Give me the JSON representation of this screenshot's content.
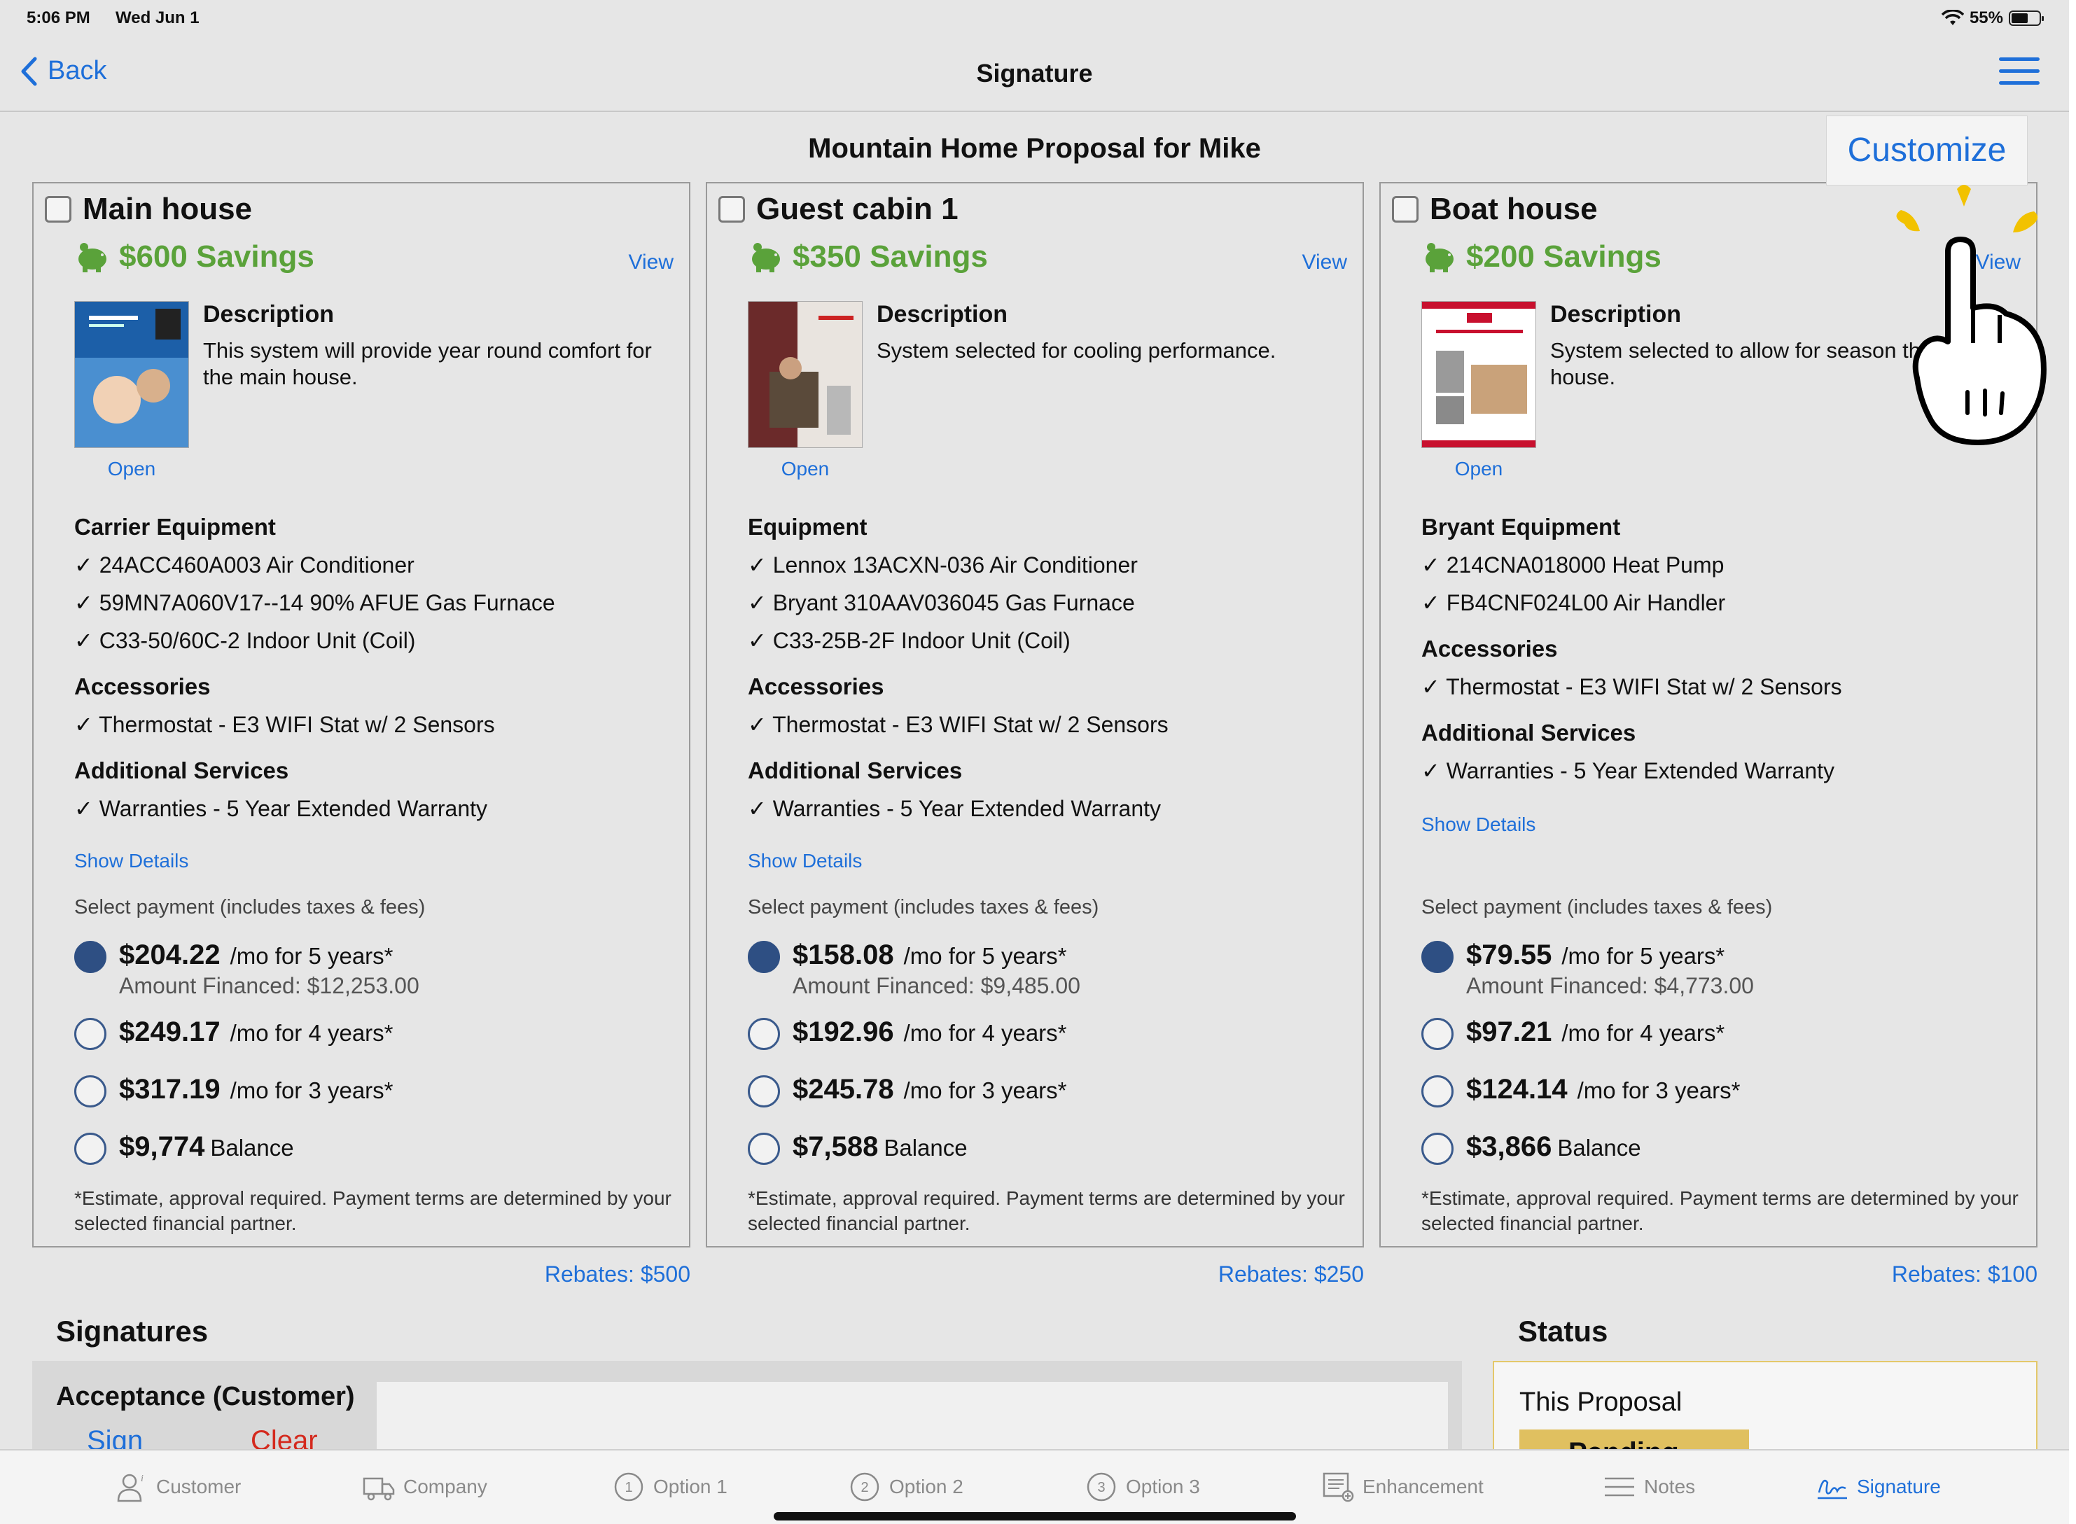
{
  "status_bar": {
    "time": "5:06 PM",
    "date": "Wed Jun 1",
    "battery": "55%"
  },
  "nav": {
    "back_label": "Back",
    "title": "Signature"
  },
  "proposal": {
    "title": "Mountain Home Proposal for Mike",
    "customize_label": "Customize"
  },
  "colors": {
    "accent": "#1e6fd9",
    "savings": "#5aa23a",
    "radio_selected": "#2e4f83",
    "clear": "#d42a1e",
    "status_badge": "#e0c060"
  },
  "options": [
    {
      "name": "Main house",
      "savings": "$600 Savings",
      "view_label": "View",
      "description_label": "Description",
      "description": "This system will provide year round comfort for the main house.",
      "open_label": "Open",
      "equipment_title": "Carrier Equipment",
      "equipment": [
        "✓ 24ACC460A003 Air Conditioner",
        "✓ 59MN7A060V17--14 90% AFUE Gas Furnace",
        "✓ C33-50/60C-2 Indoor Unit (Coil)"
      ],
      "accessories_title": "Accessories",
      "accessories": [
        "✓ Thermostat - E3 WIFI Stat w/ 2 Sensors"
      ],
      "services_title": "Additional Services",
      "services": [
        "✓ Warranties - 5 Year Extended Warranty"
      ],
      "show_details": "Show Details",
      "payment_label": "Select payment (includes taxes & fees)",
      "payments": [
        {
          "amount": "$204.22",
          "term": "/mo for 5 years*"
        },
        {
          "amount": "$249.17",
          "term": "/mo for 4 years*"
        },
        {
          "amount": "$317.19",
          "term": "/mo for 3 years*"
        },
        {
          "amount": "$9,774",
          "term": "Balance"
        }
      ],
      "financed": "Amount Financed: $12,253.00",
      "disclaimer": "*Estimate, approval required. Payment terms are determined by your selected financial partner.",
      "rebates": "Rebates: $500"
    },
    {
      "name": "Guest cabin 1",
      "savings": "$350 Savings",
      "view_label": "View",
      "description_label": "Description",
      "description": "System selected for cooling performance.",
      "open_label": "Open",
      "equipment_title": "Equipment",
      "equipment": [
        "✓ Lennox 13ACXN-036 Air Conditioner",
        "✓ Bryant 310AAV036045 Gas Furnace",
        "✓ C33-25B-2F Indoor Unit (Coil)"
      ],
      "accessories_title": "Accessories",
      "accessories": [
        "✓ Thermostat - E3 WIFI Stat w/ 2 Sensors"
      ],
      "services_title": "Additional Services",
      "services": [
        "✓ Warranties - 5 Year Extended Warranty"
      ],
      "show_details": "Show Details",
      "payment_label": "Select payment (includes taxes & fees)",
      "payments": [
        {
          "amount": "$158.08",
          "term": "/mo for 5 years*"
        },
        {
          "amount": "$192.96",
          "term": "/mo for 4 years*"
        },
        {
          "amount": "$245.78",
          "term": "/mo for 3 years*"
        },
        {
          "amount": "$7,588",
          "term": "Balance"
        }
      ],
      "financed": "Amount Financed: $9,485.00",
      "disclaimer": "*Estimate, approval required. Payment terms are determined by your selected financial partner.",
      "rebates": "Rebates: $250"
    },
    {
      "name": "Boat house",
      "savings": "$200 Savings",
      "view_label": "View",
      "description_label": "Description",
      "description": "System selected to allow for season the boat house.",
      "open_label": "Open",
      "equipment_title": "Bryant Equipment",
      "equipment": [
        "✓ 214CNA018000 Heat Pump",
        "✓ FB4CNF024L00 Air Handler"
      ],
      "accessories_title": "Accessories",
      "accessories": [
        "✓ Thermostat - E3 WIFI Stat w/ 2 Sensors"
      ],
      "services_title": "Additional Services",
      "services": [
        "✓ Warranties - 5 Year Extended Warranty"
      ],
      "show_details": "Show Details",
      "payment_label": "Select payment (includes taxes & fees)",
      "payments": [
        {
          "amount": "$79.55",
          "term": "/mo for 5 years*"
        },
        {
          "amount": "$97.21",
          "term": "/mo for 4 years*"
        },
        {
          "amount": "$124.14",
          "term": "/mo for 3 years*"
        },
        {
          "amount": "$3,866",
          "term": "Balance"
        }
      ],
      "financed": "Amount Financed: $4,773.00",
      "disclaimer": "*Estimate, approval required. Payment terms are determined by your selected financial partner.",
      "rebates": "Rebates: $100"
    }
  ],
  "signatures": {
    "title": "Signatures",
    "acceptance_label": "Acceptance (Customer)",
    "sign_label": "Sign",
    "clear_label": "Clear"
  },
  "status": {
    "title": "Status",
    "label": "This Proposal",
    "badge": "Pending"
  },
  "tabs": [
    {
      "label": "Customer",
      "icon": "customer-icon"
    },
    {
      "label": "Company",
      "icon": "truck-icon"
    },
    {
      "label": "Option 1",
      "icon": "option-1-icon"
    },
    {
      "label": "Option 2",
      "icon": "option-2-icon"
    },
    {
      "label": "Option 3",
      "icon": "option-3-icon"
    },
    {
      "label": "Enhancement",
      "icon": "enhancement-icon"
    },
    {
      "label": "Notes",
      "icon": "notes-icon"
    },
    {
      "label": "Signature",
      "icon": "signature-icon"
    }
  ]
}
